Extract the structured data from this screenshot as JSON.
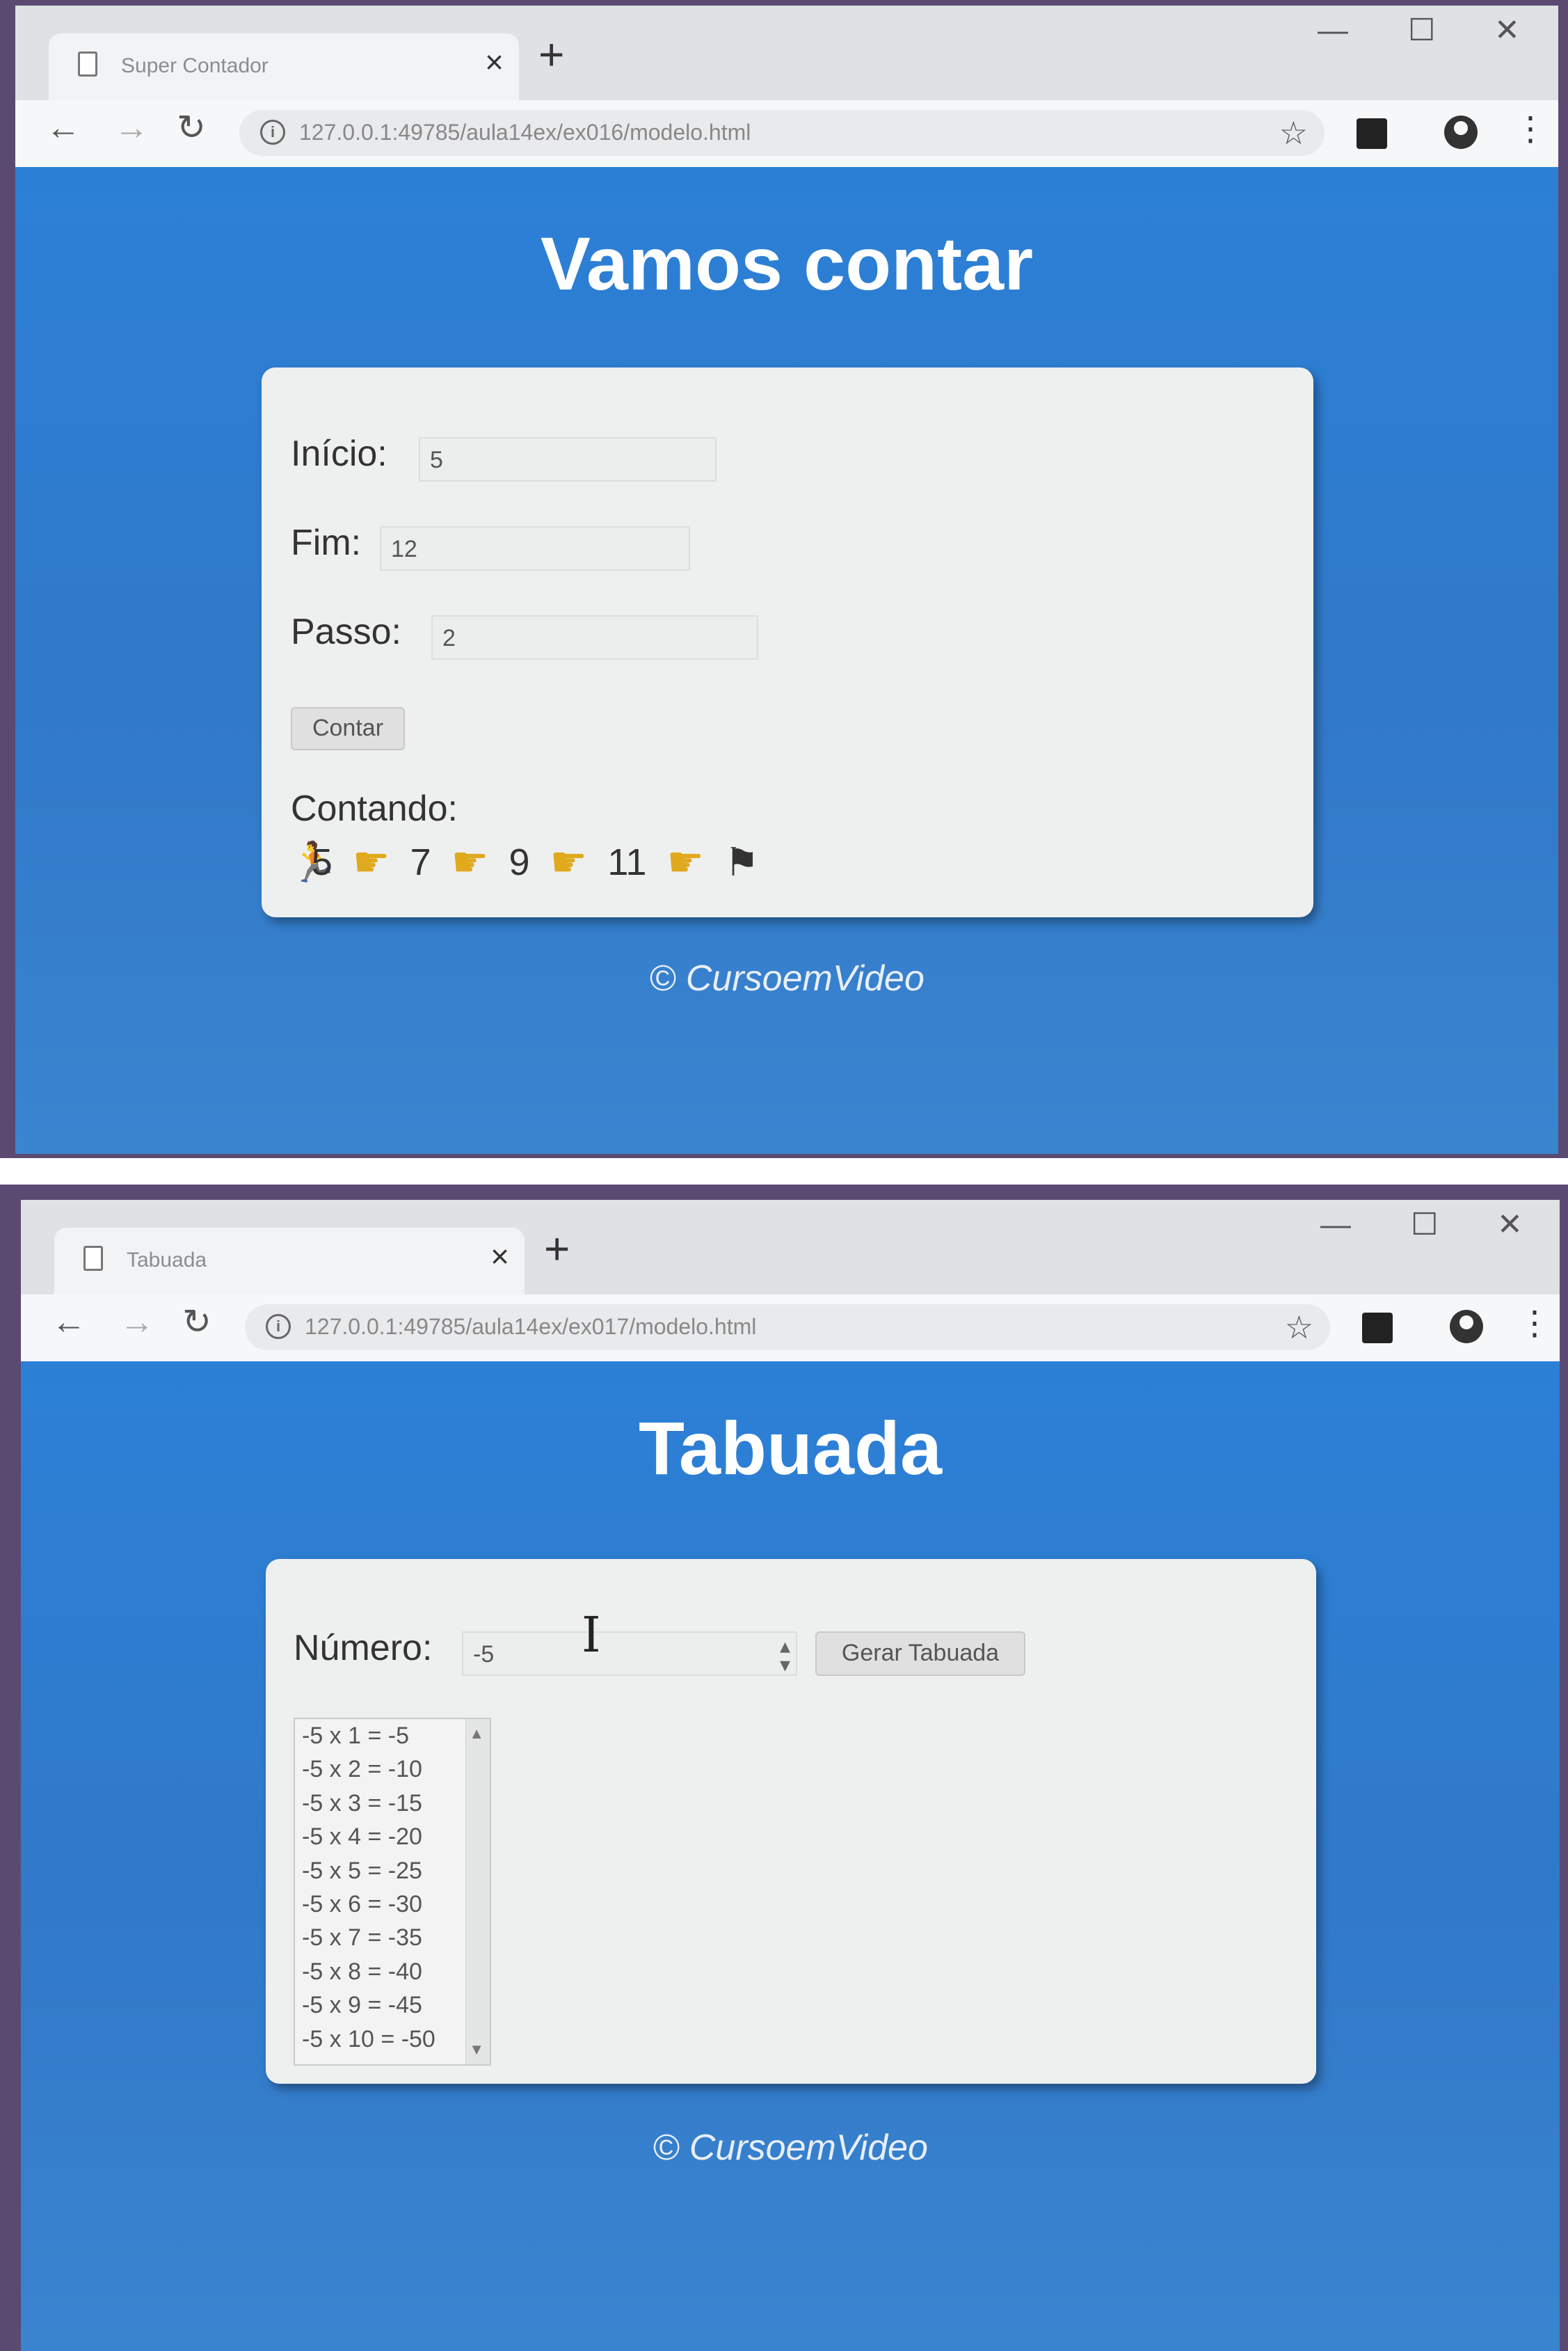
{
  "browser1": {
    "tab_title": "Super Contador",
    "tab_close": "×",
    "new_tab": "+",
    "url": "127.0.0.1:49785/aula14ex/ex016/modelo.html"
  },
  "page1": {
    "heading": "Vamos contar",
    "inicio_label": "Início:",
    "inicio_value": "5",
    "fim_label": "Fim:",
    "fim_value": "12",
    "passo_label": "Passo:",
    "passo_value": "2",
    "button_label": "Contar",
    "result_label": "Contando:",
    "counts": [
      "5",
      "7",
      "9",
      "11"
    ],
    "footer": "© CursoemVideo"
  },
  "browser2": {
    "tab_title": "Tabuada",
    "tab_close": "×",
    "new_tab": "+",
    "url": "127.0.0.1:49785/aula14ex/ex017/modelo.html"
  },
  "page2": {
    "heading": "Tabuada",
    "numero_label": "Número:",
    "numero_value": "-5",
    "button_label": "Gerar Tabuada",
    "table": [
      "-5 x 1 = -5",
      "-5 x 2 = -10",
      "-5 x 3 = -15",
      "-5 x 4 = -20",
      "-5 x 5 = -25",
      "-5 x 6 = -30",
      "-5 x 7 = -35",
      "-5 x 8 = -40",
      "-5 x 9 = -45",
      "-5 x 10 = -50"
    ],
    "footer": "© CursoemVideo"
  },
  "icons": {
    "back": "←",
    "forward": "→",
    "reload": "↻",
    "info": "i",
    "star": "☆",
    "menu": "⋮",
    "minimize": "—",
    "maximize": "☐",
    "close": "✕",
    "hand": "☛",
    "runner": "🏃",
    "flag": "⚑",
    "cursor": "I"
  },
  "colors": {
    "page_bg": "#2b80d6",
    "card_bg": "#eef0ef",
    "heading": "#ffffff",
    "hand": "#e0a91e"
  }
}
